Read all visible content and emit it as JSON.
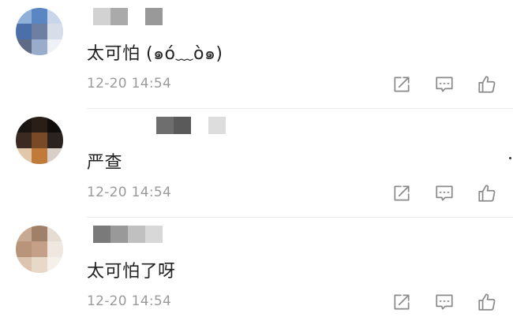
{
  "colors": {
    "text": "#222222",
    "meta": "#9a9a9a",
    "icon": "#8a8a8a",
    "divider": "#ececec"
  },
  "comments": [
    {
      "text": "太可怕 (๑ó﹏ò๑)",
      "time": "12-20 14:54",
      "avatar_colors": [
        "#8fb0d8",
        "#5a86c4",
        "#c9d6ea",
        "#4b6fa8",
        "#6e7fa1",
        "#d6deea",
        "#5f6b84",
        "#9aaccc",
        "#eef1f6"
      ],
      "name_colors": [
        "#d2d2d2",
        "#aaaaaa",
        "#ffffff",
        "#999999"
      ],
      "actions": [
        "share-icon",
        "reply-icon",
        "like-icon"
      ]
    },
    {
      "text": "严查",
      "time": "12-20 14:54",
      "avatar_colors": [
        "#1a1512",
        "#2a1e18",
        "#0f0c0a",
        "#3a2a22",
        "#7a4a26",
        "#2b2320",
        "#e0c8a8",
        "#c07a3a",
        "#d8d0c8"
      ],
      "name_colors": [
        "#6e6e6e",
        "#5a5a5a",
        "#ffffff",
        "#dddddd"
      ],
      "actions": [
        "share-icon",
        "reply-icon",
        "like-icon"
      ]
    },
    {
      "text": "太可怕了呀",
      "time": "12-20 14:54",
      "avatar_colors": [
        "#c8aa94",
        "#a08068",
        "#e6dcd2",
        "#b8947a",
        "#c4a088",
        "#f0e8e0",
        "#dcc4b0",
        "#e8d8c8",
        "#f6f0ea"
      ],
      "name_colors": [
        "#7a7a7a",
        "#999999",
        "#c0c0c0",
        "#d8d8d8"
      ],
      "actions": [
        "share-icon",
        "reply-icon",
        "like-icon"
      ]
    }
  ]
}
